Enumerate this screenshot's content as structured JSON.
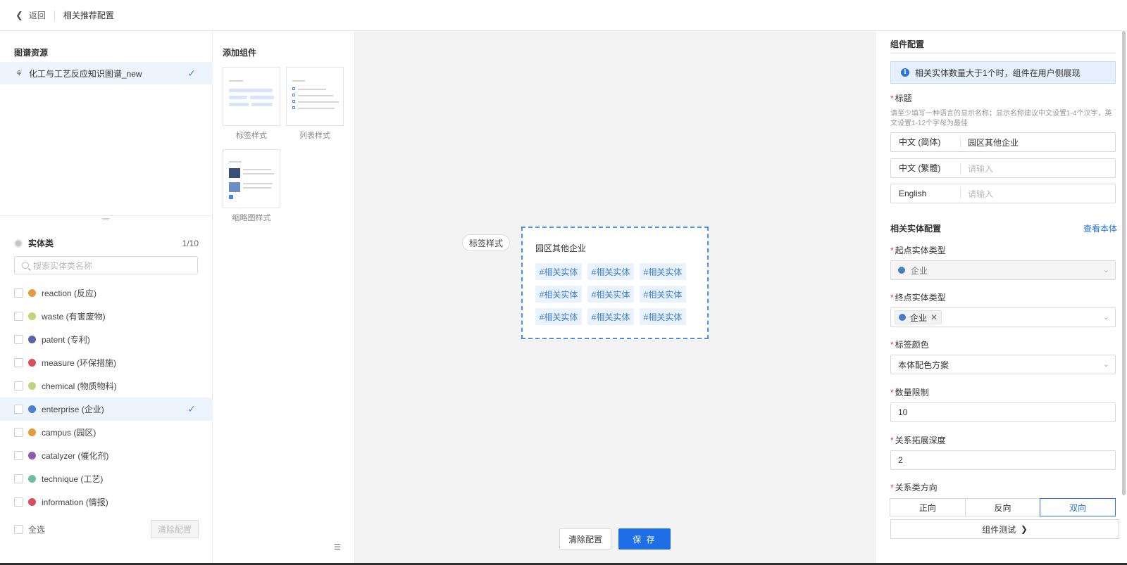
{
  "header": {
    "back_label": "返回",
    "title": "相关推荐配置"
  },
  "graph_resource": {
    "title": "图谱资源",
    "item": "化工与工艺反应知识图谱_new"
  },
  "entity_panel": {
    "title": "实体类",
    "count": "1/10",
    "search_placeholder": "搜索实体类名称",
    "items": [
      {
        "label": "reaction (反应)",
        "color": "#e59a3f",
        "selected": false
      },
      {
        "label": "waste (有害废物)",
        "color": "#bed67a",
        "selected": false
      },
      {
        "label": "patent (专利)",
        "color": "#5565a6",
        "selected": false
      },
      {
        "label": "measure (环保措施)",
        "color": "#d64f5a",
        "selected": false
      },
      {
        "label": "chemical (物质物料)",
        "color": "#bed67a",
        "selected": false
      },
      {
        "label": "enterprise (企业)",
        "color": "#4f7fd1",
        "selected": true
      },
      {
        "label": "campus (园区)",
        "color": "#e59a3f",
        "selected": false
      },
      {
        "label": "catalyzer (催化剂)",
        "color": "#8f5bab",
        "selected": false
      },
      {
        "label": "technique (工艺)",
        "color": "#6cbfa0",
        "selected": false
      },
      {
        "label": "information (情报)",
        "color": "#d64f5a",
        "selected": false
      }
    ],
    "select_all": "全选",
    "clear_config": "清除配置"
  },
  "components": {
    "title": "添加组件",
    "items": [
      {
        "label": "标签样式"
      },
      {
        "label": "列表样式"
      },
      {
        "label": "缩略图样式"
      }
    ]
  },
  "canvas": {
    "style_tag": "标签样式",
    "preview_title": "园区其他企业",
    "chips": [
      "#相关实体",
      "#相关实体",
      "#相关实体",
      "#相关实体",
      "#相关实体",
      "#相关实体",
      "#相关实体",
      "#相关实体",
      "#相关实体"
    ],
    "clear_button": "清除配置",
    "save_button": "保 存"
  },
  "config": {
    "title": "组件配置",
    "info": "相关实体数量大于1个时，组件在用户侧展现",
    "title_field": {
      "label": "标题",
      "hint": "请至少填写一种语言的显示名称；显示名称建议中文设置1-4个汉字，英文设置1-12个字母为最佳",
      "langs": [
        {
          "name": "中文 (简体)",
          "value": "园区其他企业",
          "placeholder": ""
        },
        {
          "name": "中文 (繁體)",
          "value": "",
          "placeholder": "请输入"
        },
        {
          "name": "English",
          "value": "",
          "placeholder": "请输入"
        }
      ]
    },
    "related_section": "相关实体配置",
    "view_ontology": "查看本体",
    "start_type": {
      "label": "起点实体类型",
      "value": "企业"
    },
    "end_type": {
      "label": "终点实体类型",
      "tag": "企业"
    },
    "tag_color": {
      "label": "标签颜色",
      "value": "本体配色方案"
    },
    "limit": {
      "label": "数量限制",
      "value": "10"
    },
    "depth": {
      "label": "关系拓展深度",
      "value": "2"
    },
    "direction": {
      "label": "关系类方向",
      "options": [
        "正向",
        "反向",
        "双向"
      ],
      "active": "双向"
    },
    "test_button": "组件测试"
  }
}
